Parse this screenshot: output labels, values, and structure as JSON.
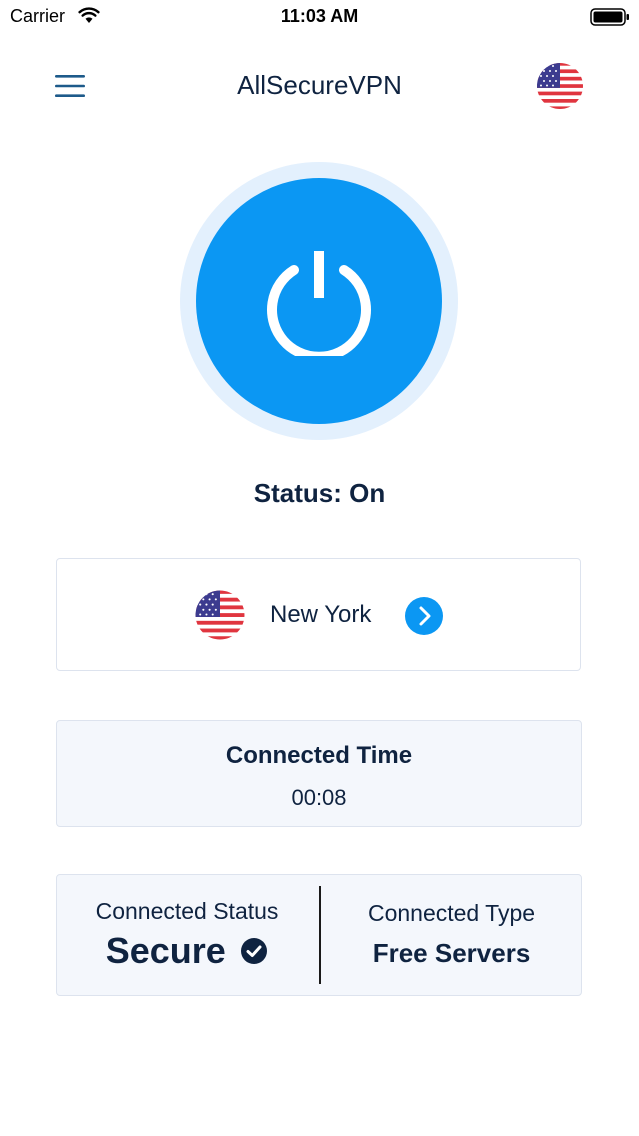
{
  "status_bar": {
    "carrier": "Carrier",
    "time": "11:03 AM"
  },
  "header": {
    "title": "AllSecureVPN",
    "menu_icon": "hamburger-menu-icon",
    "flag_icon": "us-flag-icon"
  },
  "power": {
    "icon": "power-icon",
    "status_text": "Status: On"
  },
  "location": {
    "name": "New York",
    "flag_icon": "us-flag-icon",
    "arrow_icon": "chevron-right-icon"
  },
  "connected_time": {
    "label": "Connected Time",
    "value": "00:08"
  },
  "connection_info": {
    "status_label": "Connected Status",
    "status_value": "Secure",
    "status_icon": "check-circle-icon",
    "type_label": "Connected Type",
    "type_value": "Free Servers"
  },
  "colors": {
    "accent": "#0b97f3",
    "halo": "#e3f0fd",
    "text": "#0f2340",
    "card_bg": "#f4f7fc",
    "card_border": "#dde3ee"
  }
}
